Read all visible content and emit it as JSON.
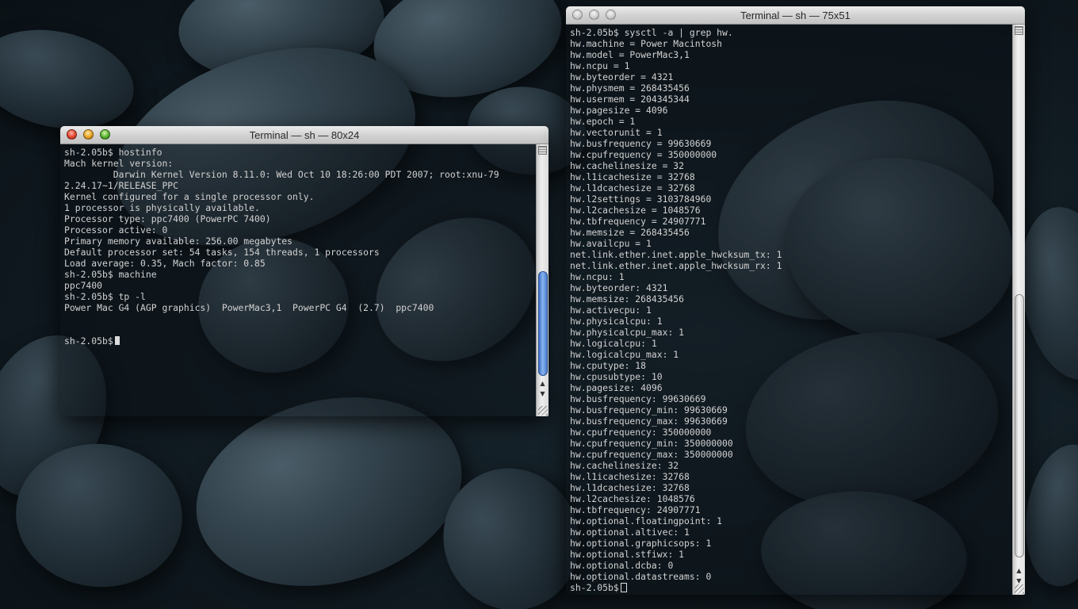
{
  "window_small": {
    "title": "Terminal — sh — 80x24",
    "lines": [
      "sh-2.05b$ hostinfo",
      "Mach kernel version:",
      "         Darwin Kernel Version 8.11.0: Wed Oct 10 18:26:00 PDT 2007; root:xnu-79",
      "2.24.17~1/RELEASE_PPC",
      "Kernel configured for a single processor only.",
      "1 processor is physically available.",
      "Processor type: ppc7400 (PowerPC 7400)",
      "Processor active: 0",
      "Primary memory available: 256.00 megabytes",
      "Default processor set: 54 tasks, 154 threads, 1 processors",
      "Load average: 0.35, Mach factor: 0.85",
      "sh-2.05b$ machine",
      "ppc7400",
      "sh-2.05b$ tp -l",
      "Power Mac G4 (AGP graphics)  PowerMac3,1  PowerPC G4  (2.7)  ppc7400",
      "",
      "",
      "sh-2.05b$"
    ],
    "scroll_position": 0.8
  },
  "window_large": {
    "title": "Terminal — sh — 75x51",
    "lines": [
      "sh-2.05b$ sysctl -a | grep hw.",
      "hw.machine = Power Macintosh",
      "hw.model = PowerMac3,1",
      "hw.ncpu = 1",
      "hw.byteorder = 4321",
      "hw.physmem = 268435456",
      "hw.usermem = 204345344",
      "hw.pagesize = 4096",
      "hw.epoch = 1",
      "hw.vectorunit = 1",
      "hw.busfrequency = 99630669",
      "hw.cpufrequency = 350000000",
      "hw.cachelinesize = 32",
      "hw.l1icachesize = 32768",
      "hw.l1dcachesize = 32768",
      "hw.l2settings = 3103784960",
      "hw.l2cachesize = 1048576",
      "hw.tbfrequency = 24907771",
      "hw.memsize = 268435456",
      "hw.availcpu = 1",
      "net.link.ether.inet.apple_hwcksum_tx: 1",
      "net.link.ether.inet.apple_hwcksum_rx: 1",
      "hw.ncpu: 1",
      "hw.byteorder: 4321",
      "hw.memsize: 268435456",
      "hw.activecpu: 1",
      "hw.physicalcpu: 1",
      "hw.physicalcpu_max: 1",
      "hw.logicalcpu: 1",
      "hw.logicalcpu_max: 1",
      "hw.cputype: 18",
      "hw.cpusubtype: 10",
      "hw.pagesize: 4096",
      "hw.busfrequency: 99630669",
      "hw.busfrequency_min: 99630669",
      "hw.busfrequency_max: 99630669",
      "hw.cpufrequency: 350000000",
      "hw.cpufrequency_min: 350000000",
      "hw.cpufrequency_max: 350000000",
      "hw.cachelinesize: 32",
      "hw.l1icachesize: 32768",
      "hw.l1dcachesize: 32768",
      "hw.l2cachesize: 1048576",
      "hw.tbfrequency: 24907771",
      "hw.optional.floatingpoint: 1",
      "hw.optional.altivec: 1",
      "hw.optional.graphicsops: 1",
      "hw.optional.stfiwx: 1",
      "hw.optional.dcba: 0",
      "hw.optional.datastreams: 0",
      "sh-2.05b$"
    ],
    "scroll_position": 1.0
  },
  "icons": {
    "close": "close-icon",
    "minimize": "minimize-icon",
    "zoom": "zoom-icon",
    "scroll_up": "▲",
    "scroll_down": "▼"
  },
  "colors": {
    "terminal_text": "#d2d2d2",
    "scroll_thumb_active": "#4e82d6",
    "desktop_background": "#121d24"
  }
}
